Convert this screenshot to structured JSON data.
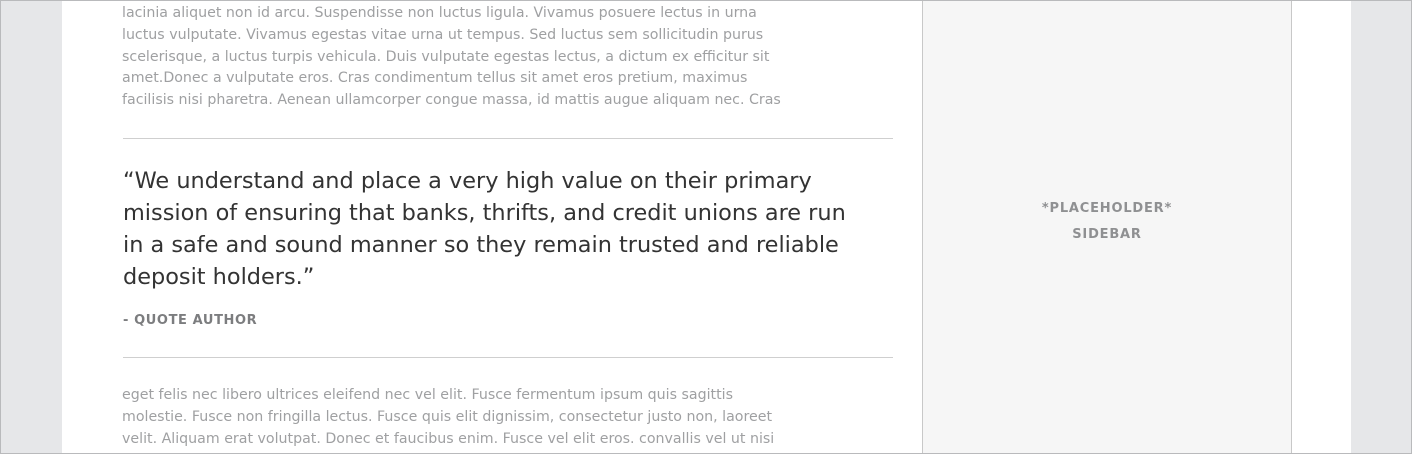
{
  "article": {
    "top_paragraph_lines": [
      "lacinia aliquet non id arcu. Suspendisse non luctus ligula. Vivamus posuere lectus in urna",
      "luctus vulputate. Vivamus egestas vitae urna ut tempus. Sed luctus sem sollicitudin purus",
      "scelerisque, a luctus turpis vehicula. Duis vulputate egestas lectus, a dictum ex efficitur sit",
      "amet.Donec a vulputate eros. Cras condimentum tellus sit amet eros pretium, maximus",
      "facilisis nisi pharetra. Aenean ullamcorper congue massa, id mattis augue aliquam nec. Cras"
    ],
    "pull_quote": {
      "lines": [
        "“We understand and place a very high value on their primary",
        "mission of ensuring that banks, thrifts, and credit unions are run",
        "in a safe and sound manner so they remain trusted and reliable",
        "deposit holders.”"
      ],
      "author": "- QUOTE AUTHOR"
    },
    "bottom_paragraph_lines": [
      "eget felis nec libero ultrices eleifend nec vel elit. Fusce fermentum ipsum quis sagittis",
      "molestie. Fusce non fringilla lectus. Fusce quis elit dignissim, consectetur justo non, laoreet",
      "velit. Aliquam erat volutpat. Donec et faucibus enim. Fusce vel elit eros. convallis vel ut nisi"
    ]
  },
  "sidebar": {
    "label_line_1": "*PLACEHOLDER*",
    "label_line_2": "SIDEBAR"
  },
  "colors": {
    "page_background": "#e6e7e9",
    "content_background": "#ffffff",
    "sidebar_background": "#f6f6f6",
    "body_text": "#9fa0a2",
    "quote_text": "#333333",
    "author_text": "#7c7d7f",
    "divider": "#cfcfcf"
  }
}
